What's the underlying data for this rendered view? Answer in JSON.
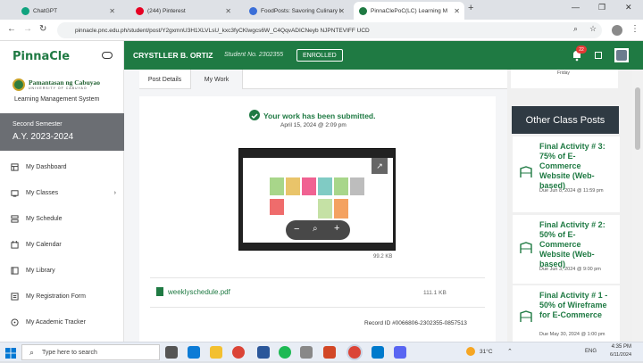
{
  "browser": {
    "tabs": [
      {
        "label": "ChatGPT",
        "color": "#10a37f",
        "icon": "chatgpt-icon"
      },
      {
        "label": "(244) Pinterest",
        "color": "#e60023",
        "icon": "pinterest-icon"
      },
      {
        "label": "FoodPosts: Savoring Culinary I",
        "color": "#3b6fd8",
        "icon": "page-icon"
      },
      {
        "label": "PinnaClePoC(LC) Learning M",
        "color": "#1f7a43",
        "icon": "pinnacle-icon"
      }
    ],
    "url": "pinnacle.pnc.edu.ph/student/post/Y2gxmnU3H1XLVLsU_kxc3fyCKlwgcs6W_C4QqvADICNeyb NJPNTEVIFF UCD",
    "close_symbol": "✕",
    "newtab_symbol": "+"
  },
  "sidebar": {
    "logo": "PinnaCle",
    "university": "Pamantasan ng Cabuyao",
    "university_sub": "UNIVERSITY OF CABUYAO",
    "system": "Learning Management System",
    "semester": "Second Semester",
    "ay": "A.Y. 2023-2024",
    "items": [
      {
        "label": "My Dashboard",
        "icon": "dashboard-icon"
      },
      {
        "label": "My Classes",
        "icon": "classes-icon"
      },
      {
        "label": "My Schedule",
        "icon": "schedule-icon"
      },
      {
        "label": "My Calendar",
        "icon": "calendar-icon"
      },
      {
        "label": "My Library",
        "icon": "library-icon"
      },
      {
        "label": "My Registration Form",
        "icon": "form-icon"
      },
      {
        "label": "My Academic Tracker",
        "icon": "tracker-icon"
      }
    ]
  },
  "header": {
    "name": "CRYSTLLER B. ORTIZ",
    "student_no": "Student No. 2302355",
    "status": "ENROLLED",
    "notif_count": "22"
  },
  "main": {
    "tabs": [
      "Post Details",
      "My Work"
    ],
    "active_tab": "My Work",
    "submitted_text": "Your work has been submitted.",
    "submitted_date": "April 15, 2024 @ 2:09 pm",
    "image_size": "99.2 KB",
    "file_name": "weeklyschedule.pdf",
    "file_size": "111.1 KB",
    "record_id": "Record ID #0066806-2302355-0857513"
  },
  "right": {
    "top_text": "Friday",
    "heading": "Other Class Posts",
    "posts": [
      {
        "title": "Final Activity # 3: 75% of E-Commerce Website (Web-based)",
        "date": "Due Jun 8, 2024 @ 11:59 pm"
      },
      {
        "title": "Final Activity # 2: 50% of E-Commerce Website (Web-based)",
        "date": "Due Jun 3, 2024 @ 9:00 pm"
      },
      {
        "title": "Final Activity # 1 - 50% of Wireframe for E-Commerce",
        "date": "Due May 30, 2024 @ 1:00 pm"
      }
    ]
  },
  "taskbar": {
    "search_placeholder": "Type here to search",
    "temp": "31°C",
    "lang": "ENG",
    "time": "4:35 PM",
    "date": "6/11/2024"
  }
}
